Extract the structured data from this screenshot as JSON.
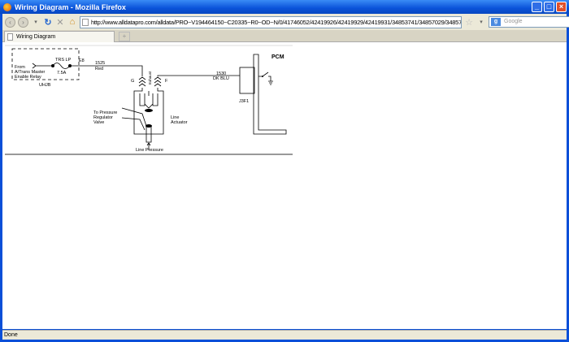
{
  "window": {
    "title": "Wiring Diagram - Mozilla Firefox"
  },
  "toolbar": {
    "url": "http://www.alldatapro.com/alldata/PRO~V194464150~C20335~R0~OD~N/0/41746052/42419926/42419929/42419931/34853741/34857029/34857030/3",
    "search_placeholder": "Google"
  },
  "tabs": [
    {
      "label": "Wiring Diagram"
    }
  ],
  "status": "Done",
  "diagram": {
    "pcm": "PCM",
    "fuse": "TRS LP",
    "fuse_rating": "7.5A",
    "source": [
      "From",
      "A/Trans Master",
      "Enable Relay"
    ],
    "junction_block": "UHJB",
    "terminal": "E8",
    "wire1_circuit": "1525",
    "wire1_color": "Red",
    "pin_g": "G",
    "pin_f": "F",
    "exhaust": "Exhaust",
    "wire2_circuit": "1530",
    "wire2_color": "DK BLU",
    "connector": "J3F1",
    "regulator": [
      "To Pressure",
      "Regulator",
      "Valve"
    ],
    "actuator": [
      "Line",
      "Actuator"
    ],
    "line_pressure": "Line Pressure"
  }
}
